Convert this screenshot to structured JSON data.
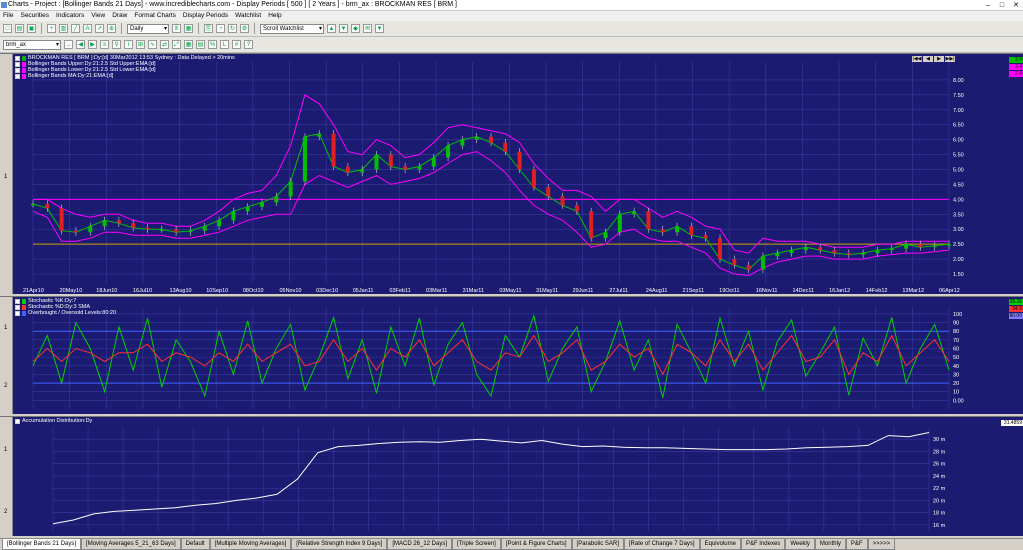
{
  "window": {
    "title": "Charts - Project : [Bollinger Bands 21 Days] - www.incrediblecharts.com - Display Periods  [ 500 ]  [ 2 Years ] - brm_ax : BROCKMAN RES  [ BRM ]",
    "controls": [
      "–",
      "□",
      "✕"
    ]
  },
  "menu": [
    "File",
    "Securities",
    "Indicators",
    "View",
    "Draw",
    "Format Charts",
    "Display Periods",
    "Watchlist",
    "Help"
  ],
  "toolbar": {
    "period": "Daily",
    "watchlist": "Scroll Watchlist",
    "security": "brm_ax"
  },
  "main": {
    "legend": [
      {
        "text": "BROCKMAN RES [ BRM ]:Dy:[d]  30Mar2012 13:53 Sydney : Data Delayed > 20mins",
        "color": "#00b000"
      },
      {
        "text": "Bollinger Bands Upper:Dy:21:2.5 Std Upper:EMA:[d]",
        "color": "#ff00ff"
      },
      {
        "text": "Bollinger Bands Lower:Dy:21:2.5 Std Lower:EMA:[d]",
        "color": "#ff00ff"
      },
      {
        "text": "Bollinger Bands MA:Dy:21:EMA:[d]",
        "color": "#ff00ff"
      }
    ],
    "price_tags": [
      "2.4",
      "2.4",
      "2.4"
    ],
    "gutter_label": "1",
    "nav": [
      "|◀◀",
      "◀",
      "▶",
      "▶▶|"
    ]
  },
  "stoch": {
    "legend": [
      {
        "text": "Stochastic %K:Dy:7",
        "color": "#00d000"
      },
      {
        "text": "Stochastic %D:Dy:3 SMA",
        "color": "#ff3030"
      },
      {
        "text": "Overbought / Oversold Levels:80:20",
        "color": "#4060ff"
      }
    ],
    "tags": [
      "28.26",
      "34.9",
      "80.00"
    ],
    "gutter_labels": [
      "1",
      "2"
    ]
  },
  "accum": {
    "legend": [
      {
        "text": "Accumulation Distribution:Dy",
        "color": "#ffffff"
      }
    ],
    "tag": "31.4859",
    "gutter_labels": [
      "1",
      "2"
    ]
  },
  "chart_data": [
    {
      "type": "line",
      "title": "BROCKMAN RES [ BRM ]",
      "x_labels": [
        "21Apr10",
        "20May10",
        "18Jun10",
        "16Jul10",
        "13Aug10",
        "10Sep10",
        "08Oct10",
        "05Nov10",
        "03Dec10",
        "05Jan11",
        "03Feb11",
        "03Mar11",
        "31Mar11",
        "03May11",
        "31May11",
        "29Jun11",
        "27Jul11",
        "24Aug11",
        "21Sep11",
        "19Oct11",
        "16Nov11",
        "14Dec11",
        "16Jan12",
        "14Feb12",
        "13Mar12",
        "06Apr12"
      ],
      "y_ticks": [
        8.0,
        7.5,
        7.0,
        6.5,
        6.0,
        5.5,
        5.0,
        4.5,
        4.0,
        3.5,
        3.0,
        2.5,
        2.0,
        1.5
      ],
      "ylim": [
        1.2,
        8.6
      ],
      "hlines": [
        {
          "value": 4.0,
          "color": "#ff00ff"
        },
        {
          "value": 2.5,
          "color": "#d0a000"
        }
      ],
      "series": [
        {
          "name": "BROCKMAN RES [ BRM ]",
          "color": "#00c000",
          "values": [
            3.85,
            3.7,
            2.95,
            2.9,
            3.1,
            3.3,
            3.2,
            3.05,
            3.0,
            3.0,
            2.9,
            2.95,
            3.1,
            3.3,
            3.6,
            3.75,
            3.9,
            4.1,
            4.6,
            6.1,
            6.2,
            5.1,
            4.9,
            5.0,
            5.5,
            5.1,
            5.0,
            5.1,
            5.4,
            5.8,
            6.0,
            6.1,
            5.9,
            5.6,
            5.0,
            4.4,
            4.1,
            3.8,
            3.6,
            2.7,
            2.9,
            3.5,
            3.6,
            3.0,
            2.9,
            3.1,
            2.8,
            2.7,
            2.0,
            1.8,
            1.65,
            2.1,
            2.2,
            2.3,
            2.4,
            2.3,
            2.2,
            2.15,
            2.2,
            2.3,
            2.35,
            2.5,
            2.4,
            2.45,
            2.5
          ]
        },
        {
          "name": "Bollinger Bands Upper",
          "color": "#ff00ff",
          "values": [
            4.0,
            4.0,
            3.7,
            3.5,
            3.4,
            3.5,
            3.5,
            3.3,
            3.2,
            3.2,
            3.1,
            3.1,
            3.3,
            3.6,
            4.0,
            4.2,
            4.3,
            4.8,
            5.8,
            7.5,
            7.2,
            6.5,
            5.6,
            5.5,
            6.0,
            5.8,
            5.4,
            5.5,
            5.9,
            6.4,
            6.5,
            6.4,
            6.3,
            6.2,
            5.9,
            5.2,
            4.7,
            4.3,
            4.3,
            4.1,
            3.6,
            4.0,
            4.0,
            3.7,
            3.4,
            3.6,
            3.4,
            3.1,
            3.0,
            2.3,
            2.2,
            2.7,
            2.6,
            2.6,
            2.6,
            2.5,
            2.4,
            2.4,
            2.4,
            2.5,
            2.5,
            2.6,
            2.6,
            2.6,
            2.6
          ]
        },
        {
          "name": "Bollinger Bands Lower",
          "color": "#ff00ff",
          "values": [
            3.6,
            3.4,
            2.6,
            2.6,
            2.7,
            2.9,
            2.9,
            2.8,
            2.8,
            2.8,
            2.7,
            2.7,
            2.8,
            2.9,
            3.1,
            3.3,
            3.4,
            3.5,
            3.5,
            4.5,
            4.8,
            4.6,
            4.4,
            4.6,
            4.8,
            4.5,
            4.6,
            4.7,
            4.9,
            5.2,
            5.5,
            5.6,
            5.3,
            4.9,
            4.3,
            3.8,
            3.5,
            3.3,
            2.9,
            2.4,
            2.5,
            2.9,
            3.0,
            2.7,
            2.6,
            2.6,
            2.4,
            2.2,
            1.7,
            1.5,
            1.45,
            1.7,
            1.9,
            2.0,
            2.1,
            2.1,
            2.0,
            2.0,
            2.0,
            2.1,
            2.15,
            2.2,
            2.2,
            2.25,
            2.3
          ]
        }
      ]
    },
    {
      "type": "line",
      "title": "Stochastic",
      "y_ticks": [
        100,
        90,
        80,
        70,
        60,
        50,
        40,
        30,
        20,
        10,
        0
      ],
      "ylim": [
        -10,
        108
      ],
      "hlines": [
        {
          "value": 80,
          "color": "#4060ff"
        },
        {
          "value": 20,
          "color": "#4060ff"
        }
      ],
      "series": [
        {
          "name": "Stochastic %K:Dy:7",
          "color": "#00d000",
          "values": [
            40,
            75,
            20,
            90,
            60,
            10,
            85,
            35,
            95,
            15,
            70,
            45,
            5,
            80,
            30,
            92,
            20,
            60,
            88,
            12,
            50,
            96,
            25,
            70,
            8,
            85,
            40,
            95,
            18,
            65,
            90,
            30,
            5,
            75,
            50,
            98,
            22,
            60,
            85,
            10,
            45,
            92,
            35,
            70,
            3,
            88,
            55,
            20,
            95,
            40,
            80,
            12,
            68,
            93,
            28,
            55,
            85,
            6,
            72,
            40,
            96,
            20,
            60,
            88,
            35
          ]
        },
        {
          "name": "Stochastic %D:Dy:3 SMA",
          "color": "#ff3030",
          "values": [
            45,
            60,
            45,
            60,
            55,
            45,
            55,
            55,
            65,
            45,
            55,
            50,
            40,
            55,
            45,
            65,
            45,
            55,
            65,
            40,
            45,
            70,
            45,
            60,
            35,
            60,
            50,
            70,
            40,
            55,
            70,
            45,
            35,
            55,
            50,
            75,
            45,
            55,
            70,
            35,
            45,
            65,
            50,
            60,
            30,
            65,
            55,
            40,
            70,
            45,
            65,
            35,
            55,
            75,
            45,
            50,
            70,
            30,
            55,
            45,
            75,
            40,
            55,
            70,
            45
          ]
        }
      ]
    },
    {
      "type": "line",
      "title": "Accumulation Distribution:Dy",
      "y_ticks": [
        "30 m",
        "28 m",
        "26 m",
        "24 m",
        "22 m",
        "20 m",
        "18 m",
        "16 m"
      ],
      "ylim": [
        15,
        32
      ],
      "series": [
        {
          "name": "Accumulation Distribution:Dy",
          "color": "#ffffff",
          "values": [
            16.2,
            16.8,
            17.8,
            18.2,
            18.4,
            18.6,
            18.8,
            19.2,
            19.5,
            20.0,
            20.4,
            21.0,
            23.5,
            27.8,
            28.8,
            29.0,
            29.3,
            29.5,
            29.6,
            29.5,
            29.8,
            30.0,
            29.7,
            29.4,
            29.8,
            29.2,
            28.8,
            28.9,
            28.7,
            28.6,
            28.6,
            28.5,
            28.4,
            28.3,
            28.3,
            28.3,
            28.4,
            28.6,
            28.7,
            28.8,
            29.0,
            30.6,
            30.4,
            31.1
          ]
        }
      ]
    }
  ],
  "tabs": [
    "[Bollinger Bands 21 Days]",
    "[Moving Averages 5_21_63 Days]",
    "Default",
    "[Multiple Moving Averages]",
    "[Relative Strength Index 9 Days]",
    "[MACD 26_12 Days]",
    "[Triple Screen]",
    "[Point & Figure Charts]",
    "[Parabolic SAR]",
    "[Rate of Change 7 Days]",
    "Equivolume",
    "P&F Indexes",
    "Weekly",
    "Monthly",
    "P&F",
    ">>>>>"
  ]
}
